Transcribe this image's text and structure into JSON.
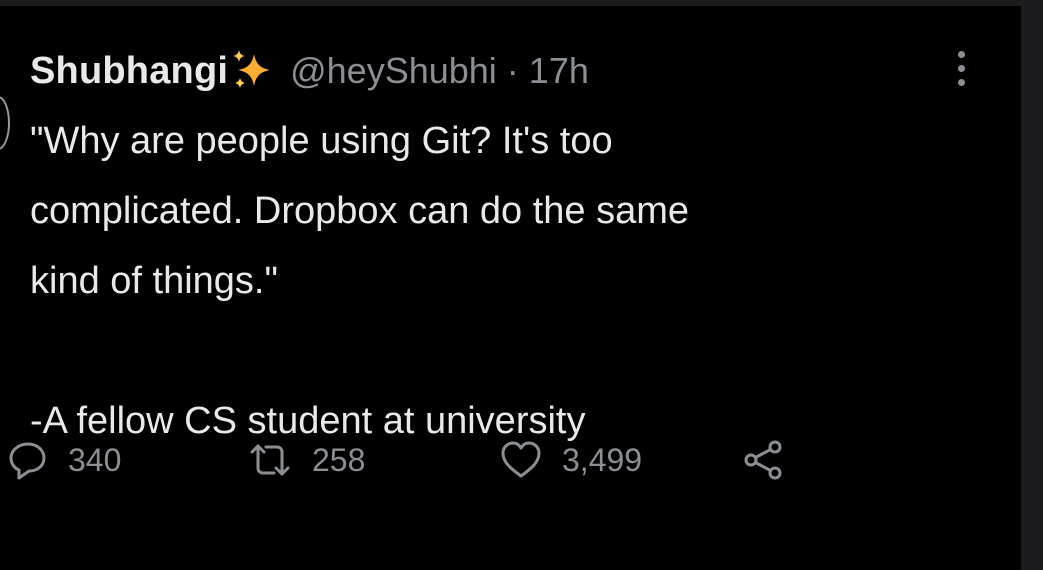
{
  "tweet": {
    "author_name": "Shubhangi",
    "name_emoji_icon": "sparkles-icon",
    "handle": "@heyShubhi",
    "separator": "·",
    "time": "17h",
    "body_lines": [
      "\"Why are people using Git? It's too",
      "complicated. Dropbox can do the same",
      "kind of things.\""
    ],
    "attribution": "-A fellow CS student at university"
  },
  "actions": {
    "reply_count": "340",
    "retweet_count": "258",
    "like_count": "3,499"
  },
  "icons": {
    "reply": "reply-icon",
    "retweet": "retweet-icon",
    "like": "heart-icon",
    "share": "share-icon",
    "more": "more-icon"
  },
  "colors": {
    "background": "#000000",
    "text": "#e7e9ea",
    "secondary_text": "#8b8f94",
    "sparkle": "#ffac33"
  }
}
